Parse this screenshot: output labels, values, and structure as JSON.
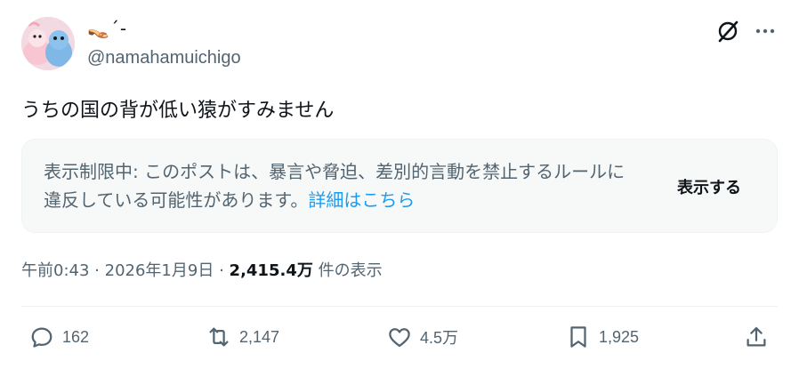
{
  "author": {
    "display_name": "👡´-",
    "handle": "@namahamuichigo"
  },
  "tweet": {
    "text": "うちの国の背が低い猿がすみません"
  },
  "notice": {
    "text": "表示制限中: このポストは、暴言や脅迫、差別的言動を禁止するルールに違反している可能性があります。",
    "link": "詳細はこちら",
    "show_button": "表示する"
  },
  "meta": {
    "time": "午前0:43",
    "separator": "·",
    "date": "2026年1月9日",
    "views": "2,415.4万",
    "views_suffix": "件の表示"
  },
  "actions": {
    "replies": "162",
    "reposts": "2,147",
    "likes": "4.5万",
    "bookmarks": "1,925"
  },
  "icons": [
    "grok-icon",
    "more-icon",
    "reply-icon",
    "repost-icon",
    "like-icon",
    "bookmark-icon",
    "share-icon"
  ],
  "colors": {
    "text": "#0f1419",
    "secondary": "#536471",
    "link": "#1d9bf0",
    "notice_bg": "#f7f9f9"
  }
}
